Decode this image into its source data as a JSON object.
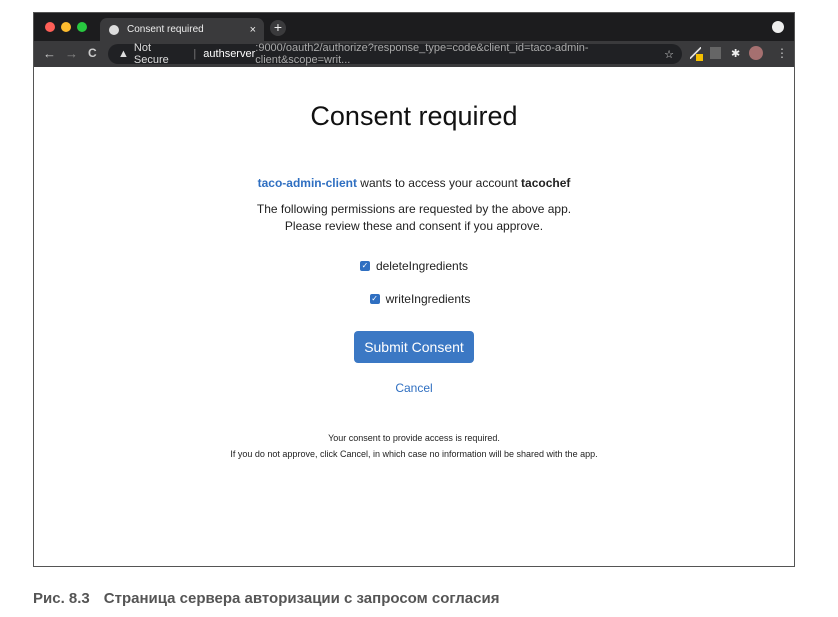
{
  "browser": {
    "tab_title": "Consent required",
    "tab_close": "×",
    "new_tab": "+",
    "security_label": "Not Secure",
    "url_host": "authserver",
    "url_rest": ":9000/oauth2/authorize?response_type=code&client_id=taco-admin-client&scope=writ...",
    "nav": {
      "back": "←",
      "forward": "→",
      "reload": "C"
    },
    "star": "☆",
    "menu": "⋮",
    "traffic_colors": [
      "#ff5f57",
      "#febc2e",
      "#28c840"
    ]
  },
  "page": {
    "title": "Consent required",
    "client_id": "taco-admin-client",
    "wants_text": " wants to access your account ",
    "account": "tacochef",
    "info_line1": "The following permissions are requested by the above app.",
    "info_line2": "Please review these and consent if you approve.",
    "scopes": [
      {
        "label": "deleteIngredients",
        "checked": true
      },
      {
        "label": "writeIngredients",
        "checked": true
      }
    ],
    "submit_label": "Submit Consent",
    "cancel_label": "Cancel",
    "note1": "Your consent to provide access is required.",
    "note2": "If you do not approve, click Cancel, in which case no information will be shared with the app."
  },
  "caption": {
    "number": "Рис. 8.3",
    "text": "Страница сервера авторизации с запросом согласия"
  }
}
